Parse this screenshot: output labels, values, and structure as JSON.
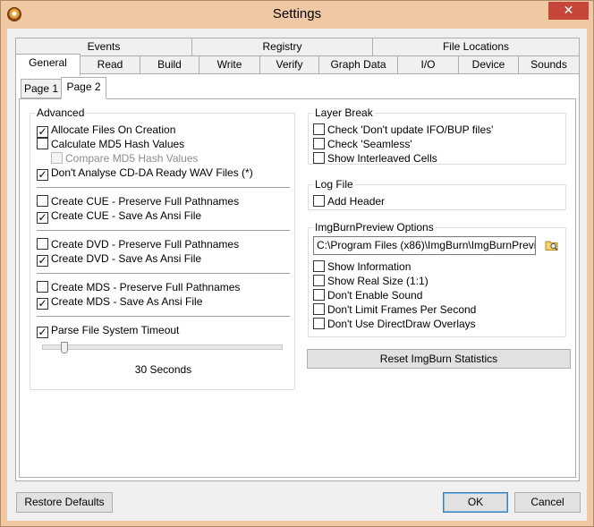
{
  "window": {
    "title": "Settings",
    "close_glyph": "✕"
  },
  "tabs_row1": [
    "Events",
    "Registry",
    "File Locations"
  ],
  "tabs_row2": [
    "General",
    "Read",
    "Build",
    "Write",
    "Verify",
    "Graph Data",
    "I/O",
    "Device",
    "Sounds"
  ],
  "active_tab": "General",
  "subtabs": [
    "Page 1",
    "Page 2"
  ],
  "active_subtab": "Page 2",
  "advanced": {
    "title": "Advanced",
    "items": [
      {
        "label": "Allocate Files On Creation",
        "checked": true
      },
      {
        "label": "Calculate MD5 Hash Values",
        "checked": false
      },
      {
        "label": "Compare MD5 Hash Values",
        "checked": false,
        "disabled": true
      },
      {
        "label": "Don't Analyse CD-DA Ready WAV Files (*)",
        "checked": true
      },
      {
        "label": "Create CUE - Preserve Full Pathnames",
        "checked": false
      },
      {
        "label": "Create CUE - Save As Ansi File",
        "checked": true
      },
      {
        "label": "Create DVD - Preserve Full Pathnames",
        "checked": false
      },
      {
        "label": "Create DVD - Save As Ansi File",
        "checked": true
      },
      {
        "label": "Create MDS - Preserve Full Pathnames",
        "checked": false
      },
      {
        "label": "Create MDS - Save As Ansi File",
        "checked": true
      },
      {
        "label": "Parse File System Timeout",
        "checked": true
      }
    ],
    "timeout_label": "30 Seconds",
    "timeout_fraction": 0.08
  },
  "layer_break": {
    "title": "Layer Break",
    "items": [
      {
        "label": "Check 'Don't update IFO/BUP files'",
        "checked": false
      },
      {
        "label": "Check 'Seamless'",
        "checked": false
      },
      {
        "label": "Show Interleaved Cells",
        "checked": false
      }
    ]
  },
  "log_file": {
    "title": "Log File",
    "items": [
      {
        "label": "Add Header",
        "checked": false
      }
    ]
  },
  "preview": {
    "title": "ImgBurnPreview Options",
    "path_value": "C:\\Program Files (x86)\\ImgBurn\\ImgBurnPrevi",
    "items": [
      {
        "label": "Show Information",
        "checked": false
      },
      {
        "label": "Show Real Size (1:1)",
        "checked": false
      },
      {
        "label": "Don't Enable Sound",
        "checked": false
      },
      {
        "label": "Don't Limit Frames Per Second",
        "checked": false
      },
      {
        "label": "Don't Use DirectDraw Overlays",
        "checked": false
      }
    ]
  },
  "reset_stats_label": "Reset ImgBurn Statistics",
  "footer": {
    "restore_label": "Restore Defaults",
    "ok_label": "OK",
    "cancel_label": "Cancel"
  },
  "check_glyph": "✓",
  "icons": {
    "browse": "folder-search-icon",
    "app": "imgburn-app-icon",
    "close": "close-icon"
  },
  "colors": {
    "titlebar": "#f0c8a4",
    "close": "#c7463a",
    "dialog": "#f0f0f0"
  }
}
